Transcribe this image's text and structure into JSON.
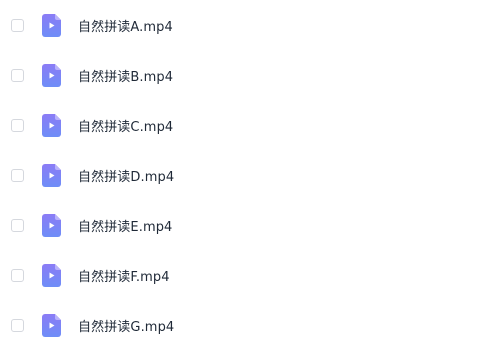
{
  "files": [
    {
      "name": "自然拼读A.mp4",
      "icon": "video-file-icon"
    },
    {
      "name": "自然拼读B.mp4",
      "icon": "video-file-icon"
    },
    {
      "name": "自然拼读C.mp4",
      "icon": "video-file-icon"
    },
    {
      "name": "自然拼读D.mp4",
      "icon": "video-file-icon"
    },
    {
      "name": "自然拼读E.mp4",
      "icon": "video-file-icon"
    },
    {
      "name": "自然拼读F.mp4",
      "icon": "video-file-icon"
    },
    {
      "name": "自然拼读G.mp4",
      "icon": "video-file-icon"
    }
  ],
  "colors": {
    "icon_top": "#8b7cf6",
    "icon_bottom": "#6e8df7",
    "checkbox_border": "#d5d8de",
    "text": "#1f2937"
  }
}
